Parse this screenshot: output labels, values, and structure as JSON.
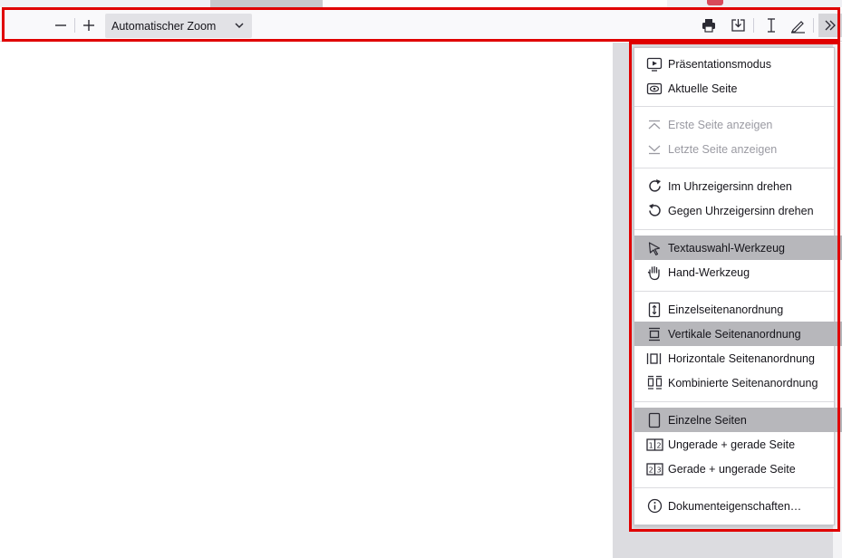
{
  "toolbar": {
    "zoom_out_icon": "minus-icon",
    "zoom_in_icon": "plus-icon",
    "zoom_value": "Automatischer Zoom",
    "print_icon": "printer-icon",
    "save_icon": "download-icon",
    "text_tool_icon": "text-cursor-icon",
    "draw_tool_icon": "pen-icon",
    "more_icon": "double-chevron-right-icon"
  },
  "menu": {
    "items": [
      {
        "label": "Präsentationsmodus",
        "icon": "presentation-icon",
        "state": "normal"
      },
      {
        "label": "Aktuelle Seite",
        "icon": "eye-icon",
        "state": "normal"
      },
      {
        "label": "Erste Seite anzeigen",
        "icon": "first-page-icon",
        "state": "disabled"
      },
      {
        "label": "Letzte Seite anzeigen",
        "icon": "last-page-icon",
        "state": "disabled"
      },
      {
        "label": "Im Uhrzeigersinn drehen",
        "icon": "rotate-cw-icon",
        "state": "normal"
      },
      {
        "label": "Gegen Uhrzeigersinn drehen",
        "icon": "rotate-ccw-icon",
        "state": "normal"
      },
      {
        "label": "Textauswahl-Werkzeug",
        "icon": "cursor-arrow-icon",
        "state": "active"
      },
      {
        "label": "Hand-Werkzeug",
        "icon": "hand-icon",
        "state": "normal"
      },
      {
        "label": "Einzelseitenanordnung",
        "icon": "page-scroll-icon",
        "state": "normal"
      },
      {
        "label": "Vertikale Seitenanordnung",
        "icon": "vertical-scroll-icon",
        "state": "active"
      },
      {
        "label": "Horizontale Seitenanordnung",
        "icon": "horizontal-scroll-icon",
        "state": "normal"
      },
      {
        "label": "Kombinierte Seitenanordnung",
        "icon": "wrapped-scroll-icon",
        "state": "normal"
      },
      {
        "label": "Einzelne Seiten",
        "icon": "single-page-icon",
        "state": "active"
      },
      {
        "label": "Ungerade + gerade Seite",
        "icon": "odd-spread-icon",
        "state": "normal"
      },
      {
        "label": "Gerade + ungerade Seite",
        "icon": "even-spread-icon",
        "state": "normal"
      },
      {
        "label": "Dokumenteigenschaften…",
        "icon": "info-icon",
        "state": "normal"
      }
    ]
  },
  "colors": {
    "highlight": "#e00000",
    "active_item": "#b7b7bb",
    "disabled_text": "#9a9aa2"
  }
}
